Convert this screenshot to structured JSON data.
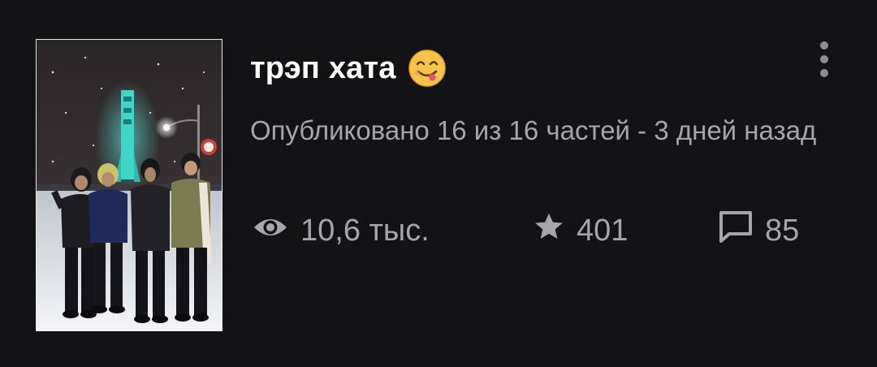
{
  "story": {
    "title": "трэп хата",
    "title_emoji": "😋",
    "subtitle": "Опубликовано 16 из 16 частей - 3 дней назад",
    "stats": {
      "views": "10,6 тыс.",
      "stars": "401",
      "comments": "85"
    }
  },
  "icons": {
    "views": "eye-icon",
    "stars": "star-icon",
    "comments": "comment-bubble-icon",
    "menu": "more-vertical-icon"
  },
  "colors": {
    "background": "#131215",
    "title": "#ffffff",
    "muted": "#a7a5ac",
    "menu_dots": "#8e8c93"
  }
}
